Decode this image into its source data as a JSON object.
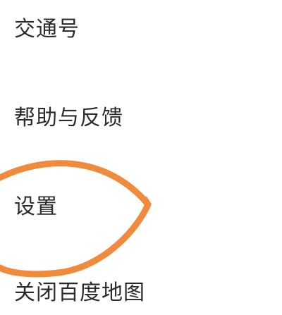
{
  "menu": {
    "items": [
      {
        "label": "交通号"
      },
      {
        "label": "帮助与反馈"
      },
      {
        "label": "设置"
      },
      {
        "label": "关闭百度地图"
      }
    ]
  },
  "annotation": {
    "stroke_color": "#f08a3c",
    "shape": "hand-drawn-circle",
    "highlights": "设置"
  }
}
